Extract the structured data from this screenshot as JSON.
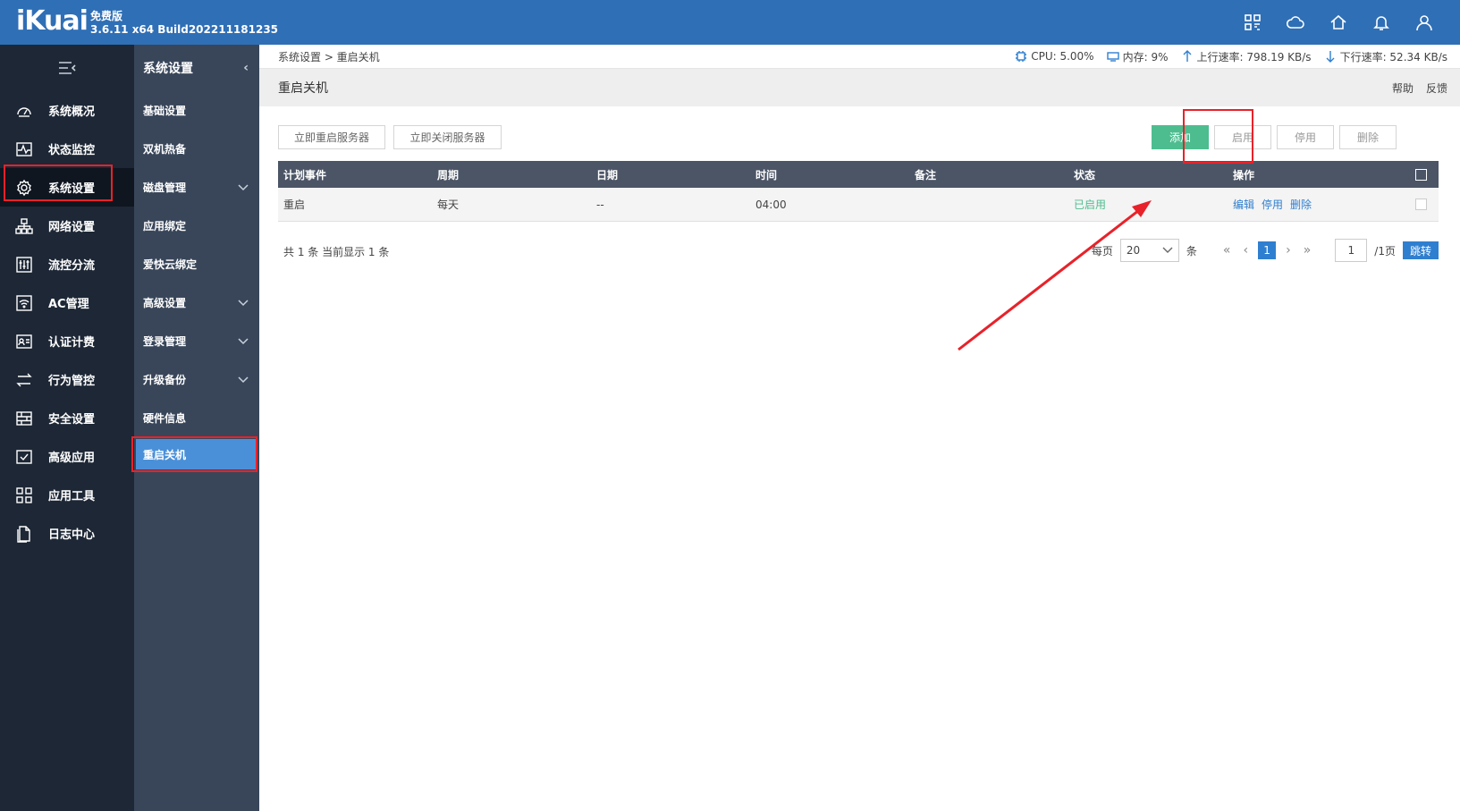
{
  "header": {
    "logo": "iKuai",
    "edition": "免费版",
    "version": "3.6.11 x64 Build202211181235",
    "icons": [
      "apps-grid-icon",
      "cloud-icon",
      "home-icon",
      "bell-icon",
      "user-icon"
    ]
  },
  "sidebar": {
    "items": [
      {
        "label": "系统概况",
        "icon": "dashboard-icon"
      },
      {
        "label": "状态监控",
        "icon": "pulse-icon"
      },
      {
        "label": "系统设置",
        "icon": "gear-icon"
      },
      {
        "label": "网络设置",
        "icon": "network-icon"
      },
      {
        "label": "流控分流",
        "icon": "sliders-icon"
      },
      {
        "label": "AC管理",
        "icon": "wifi-icon"
      },
      {
        "label": "认证计费",
        "icon": "id-card-icon"
      },
      {
        "label": "行为管控",
        "icon": "swap-icon"
      },
      {
        "label": "安全设置",
        "icon": "firewall-icon"
      },
      {
        "label": "高级应用",
        "icon": "check-box-icon"
      },
      {
        "label": "应用工具",
        "icon": "tools-grid-icon"
      },
      {
        "label": "日志中心",
        "icon": "document-icon"
      }
    ]
  },
  "subsidebar": {
    "title": "系统设置",
    "items": [
      {
        "label": "基础设置",
        "expandable": false
      },
      {
        "label": "双机热备",
        "expandable": false
      },
      {
        "label": "磁盘管理",
        "expandable": true
      },
      {
        "label": "应用绑定",
        "expandable": false
      },
      {
        "label": "爱快云绑定",
        "expandable": false
      },
      {
        "label": "高级设置",
        "expandable": true
      },
      {
        "label": "登录管理",
        "expandable": true
      },
      {
        "label": "升级备份",
        "expandable": true
      },
      {
        "label": "硬件信息",
        "expandable": false
      },
      {
        "label": "重启关机",
        "expandable": false
      }
    ]
  },
  "breadcrumb": "系统设置 > 重启关机",
  "stats": {
    "cpu": "CPU: 5.00%",
    "mem": "内存: 9%",
    "up": "上行速率: 798.19 KB/s",
    "down": "下行速率: 52.34 KB/s"
  },
  "page": {
    "title": "重启关机",
    "help": "帮助",
    "feedback": "反馈"
  },
  "toolbar": {
    "reboot_now": "立即重启服务器",
    "shutdown_now": "立即关闭服务器",
    "add": "添加",
    "enable": "启用",
    "disable": "停用",
    "delete": "删除"
  },
  "table": {
    "columns": [
      "计划事件",
      "周期",
      "日期",
      "时间",
      "备注",
      "状态",
      "操作"
    ],
    "rows": [
      {
        "event": "重启",
        "cycle": "每天",
        "date": "--",
        "time": "04:00",
        "note": "",
        "status": "已启用",
        "ops": [
          "编辑",
          "停用",
          "删除"
        ]
      }
    ]
  },
  "pager": {
    "summary": "共 1 条 当前显示 1 条",
    "per_page_label": "每页",
    "per_page": "20",
    "unit": "条",
    "current_page": "1",
    "page_input": "1",
    "total_pages": "/1页",
    "jump": "跳转"
  },
  "colors": {
    "header": "#2f6fb6",
    "sidebar": "#1d2735",
    "subsidebar": "#39465a",
    "accent": "#4a90d9",
    "success": "#4dbd8f",
    "annotation": "#e8222a"
  }
}
